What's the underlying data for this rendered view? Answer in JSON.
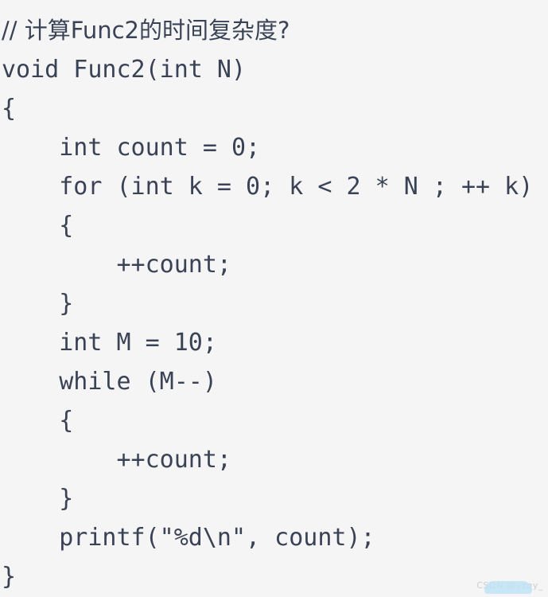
{
  "figure": {
    "kind": "code-snippet-image",
    "background_color": "#f5f5f5",
    "text_color": "#3a4256",
    "language": "C"
  },
  "code": {
    "lines": [
      "// 计算Func2的时间复杂度?",
      "void Func2(int N)",
      "{",
      "    int count = 0;",
      "    for (int k = 0; k < 2 * N ; ++ k)",
      "    {",
      "        ++count;",
      "    }",
      "    int M = 10;",
      "    while (M--)",
      "    {",
      "        ++count;",
      "    }",
      "    printf(\"%d\\n\", count);",
      "}"
    ]
  },
  "watermark": {
    "text": "CSDN @yzqy_",
    "color": "#c9cdd2",
    "blob_color": "#bfe3f5"
  }
}
